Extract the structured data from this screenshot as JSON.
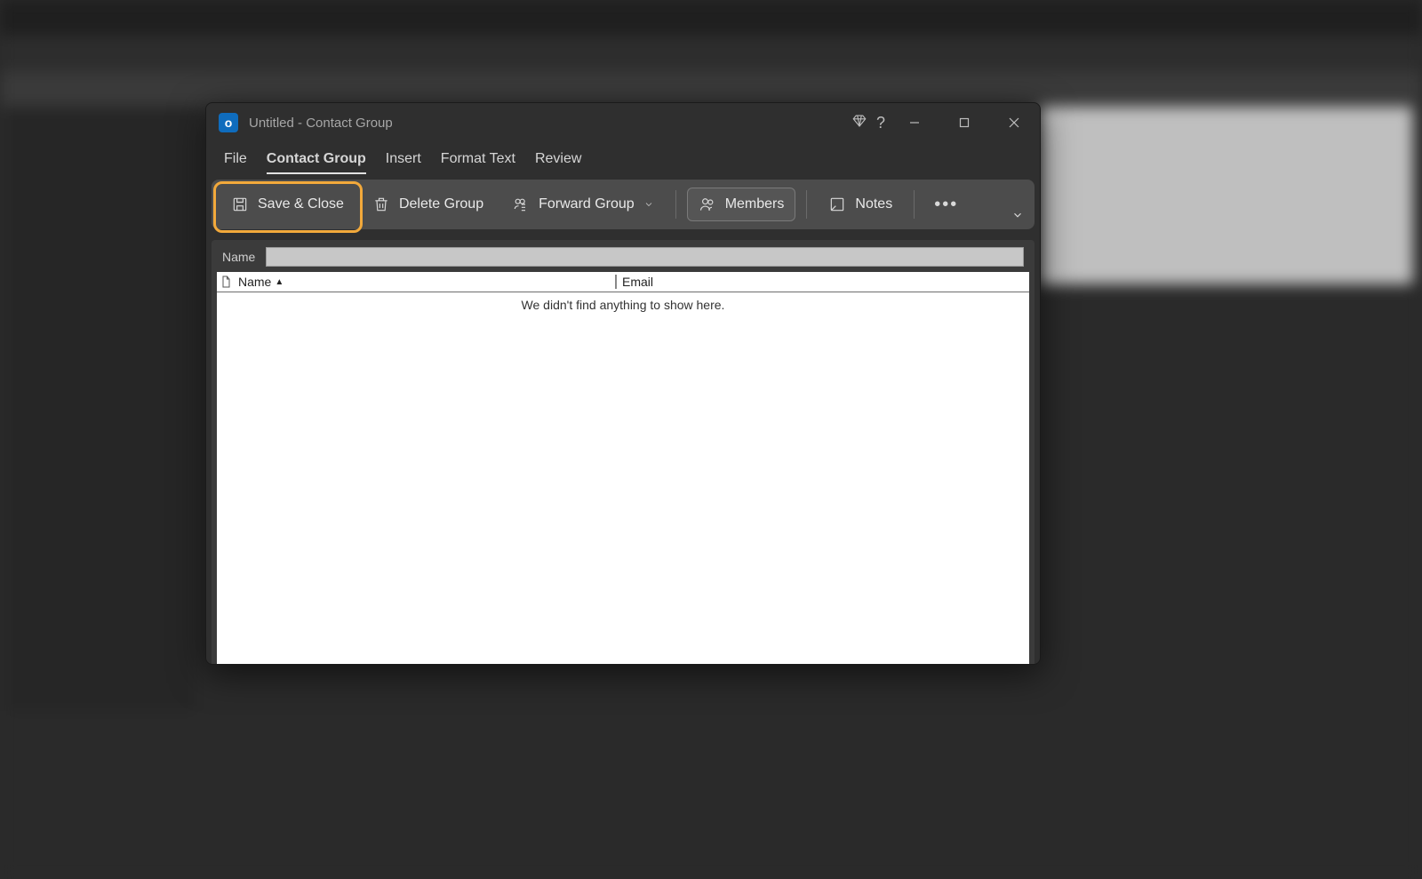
{
  "window": {
    "title": "Untitled  -  Contact Group"
  },
  "tabs": {
    "items": [
      "File",
      "Contact Group",
      "Insert",
      "Format Text",
      "Review"
    ],
    "active_index": 1
  },
  "ribbon": {
    "save_close": "Save & Close",
    "delete_group": "Delete Group",
    "forward_group": "Forward Group",
    "members": "Members",
    "notes": "Notes"
  },
  "form": {
    "name_label": "Name",
    "columns": {
      "name": "Name",
      "email": "Email"
    },
    "empty_message": "We didn't find anything to show here."
  }
}
